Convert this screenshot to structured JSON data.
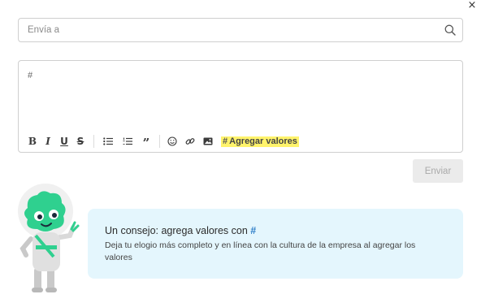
{
  "close": {
    "label": "×"
  },
  "search": {
    "placeholder": "Envía a"
  },
  "editor": {
    "text": "#",
    "toolbar": {
      "bold": "B",
      "italic": "I",
      "underline": "U",
      "strikethrough": "S",
      "quote": "”",
      "values_hash": "#",
      "values_label": "Agregar valores"
    }
  },
  "send": {
    "label": "Enviar"
  },
  "tip": {
    "title": "Un consejo: agrega valores con",
    "title_hash": "#",
    "body": "Deja tu elogio más completo y en línea con la cultura de la empresa al agregar los valores"
  },
  "colors": {
    "highlight": "#fff36b",
    "tip_bg": "#e4f6fd",
    "mascot_green": "#2fd08f",
    "hash_blue": "#2f7fc8"
  },
  "icons": {
    "search": "search-icon",
    "bullet_list": "bullet-list-icon",
    "numbered_list": "numbered-list-icon",
    "emoji": "emoji-icon",
    "link": "link-icon",
    "image": "image-icon"
  }
}
